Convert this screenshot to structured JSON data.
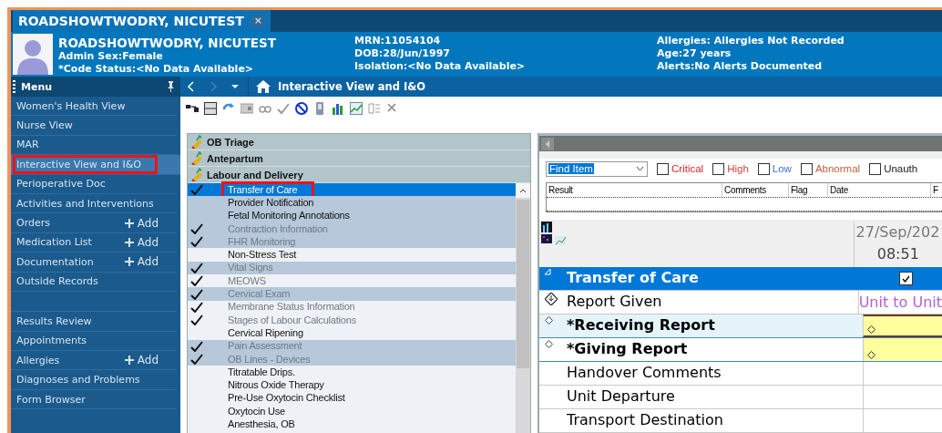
{
  "tab": {
    "label": "ROADSHOWTWODRY, NICUTEST",
    "close": "×",
    "selected": true
  },
  "banner": {
    "name": "ROADSHOWTWODRY, NICUTEST",
    "column_1": [
      "Admin Sex:Female",
      "*Code Status:<No Data Available>"
    ],
    "column_2": [
      "MRN:11054104",
      "DOB:28/Jun/1997",
      "Isolation:<No Data Available>"
    ],
    "column_3": [
      "Allergies: Allergies Not Recorded",
      "Age:27 years",
      "Alerts:No Alerts Documented"
    ]
  },
  "menu": {
    "title": "Menu",
    "items": [
      {
        "kind": "link",
        "label": "Women's Health View",
        "selected": false,
        "outlined": false
      },
      {
        "kind": "link",
        "label": "Nurse View",
        "selected": false,
        "outlined": false
      },
      {
        "kind": "link",
        "label": "MAR",
        "selected": false,
        "outlined": false
      },
      {
        "kind": "link",
        "label": "Interactive View and I&O",
        "selected": true,
        "outlined": true
      },
      {
        "kind": "link",
        "label": "Perioperative Doc",
        "selected": false,
        "outlined": false
      },
      {
        "kind": "link",
        "label": "Activities and Interventions",
        "selected": false,
        "outlined": false
      },
      {
        "kind": "link",
        "label": "Orders",
        "add": "Add",
        "selected": false,
        "outlined": false
      },
      {
        "kind": "link",
        "label": "Medication List",
        "add": "Add",
        "selected": false,
        "outlined": false
      },
      {
        "kind": "link",
        "label": "Documentation",
        "add": "Add",
        "selected": false,
        "outlined": false
      },
      {
        "kind": "link",
        "label": "Outside Records",
        "selected": false,
        "outlined": false
      },
      {
        "kind": "gap"
      },
      {
        "kind": "link",
        "label": "Results Review",
        "selected": false,
        "outlined": false
      },
      {
        "kind": "link",
        "label": "Appointments",
        "selected": false,
        "outlined": false
      },
      {
        "kind": "link",
        "label": "Allergies",
        "add": "Add",
        "selected": false,
        "outlined": false
      },
      {
        "kind": "link",
        "label": "Diagnoses and Problems",
        "selected": false,
        "outlined": false
      },
      {
        "kind": "link",
        "label": "Form Browser",
        "selected": false,
        "outlined": false
      }
    ]
  },
  "nav": {
    "title": "Interactive View and I&O"
  },
  "bands": [
    "OB Triage",
    "Antepartum",
    "Labour and Delivery"
  ],
  "sections": [
    {
      "label": "Transfer of Care",
      "checked": true,
      "selected": true,
      "outlined": true
    },
    {
      "label": "Provider Notification",
      "checked": false,
      "shaded": true,
      "selected": false,
      "outlined": false
    },
    {
      "label": "Fetal Monitoring Annotations",
      "checked": false,
      "shaded": true,
      "selected": false,
      "outlined": false
    },
    {
      "label": "Contraction Information",
      "checked": true,
      "shaded": true,
      "selected": false,
      "outlined": false
    },
    {
      "label": "FHR Monitoring",
      "checked": true,
      "shaded": true,
      "selected": false,
      "outlined": false
    },
    {
      "label": "Non-Stress Test",
      "checked": false,
      "shaded": false,
      "selected": false,
      "outlined": false
    },
    {
      "label": "Vital Signs",
      "checked": true,
      "shaded": true,
      "selected": false,
      "outlined": false
    },
    {
      "label": "MEOWS",
      "checked": true,
      "shaded": false,
      "selected": false,
      "outlined": false
    },
    {
      "label": "Cervical Exam",
      "checked": true,
      "shaded": true,
      "selected": false,
      "outlined": false
    },
    {
      "label": "Membrane Status Information",
      "checked": true,
      "shaded": false,
      "selected": false,
      "outlined": false
    },
    {
      "label": "Stages of Labour Calculations",
      "checked": true,
      "shaded": false,
      "selected": false,
      "outlined": false
    },
    {
      "label": "Cervical Ripening",
      "checked": false,
      "shaded": false,
      "selected": false,
      "outlined": false
    },
    {
      "label": "Pain Assessment",
      "checked": true,
      "shaded": true,
      "selected": false,
      "outlined": false
    },
    {
      "label": "OB Lines - Devices",
      "checked": true,
      "shaded": true,
      "selected": false,
      "outlined": false
    },
    {
      "label": "Titratable Drips.",
      "checked": false,
      "shaded": false,
      "selected": false,
      "outlined": false
    },
    {
      "label": "Nitrous Oxide Therapy",
      "checked": false,
      "shaded": false,
      "selected": false,
      "outlined": false
    },
    {
      "label": "Pre-Use Oxytocin Checklist",
      "checked": false,
      "shaded": false,
      "selected": false,
      "outlined": false
    },
    {
      "label": "Oxytocin Use",
      "checked": false,
      "shaded": false,
      "selected": false,
      "outlined": false
    },
    {
      "label": "Anesthesia, OB",
      "checked": false,
      "shaded": false,
      "selected": false,
      "outlined": false
    }
  ],
  "filter": {
    "find": "Find Item",
    "flags": [
      {
        "label": "Critical",
        "checked": false,
        "color": "#e02424"
      },
      {
        "label": "High",
        "checked": false,
        "color": "#d0453a"
      },
      {
        "label": "Low",
        "checked": false,
        "color": "#3a6ee0"
      },
      {
        "label": "Abnormal",
        "checked": false,
        "color": "#c0603a"
      },
      {
        "label": "Unauth",
        "checked": false,
        "color": "#202020"
      }
    ]
  },
  "results_table": {
    "columns": [
      "Result",
      "Comments",
      "Flag",
      "Date",
      "F"
    ]
  },
  "flowsheet": {
    "date": "27/Sep/202",
    "time": "08:51",
    "rows": [
      {
        "kind": "section",
        "label": "Transfer of Care",
        "checked": true
      },
      {
        "kind": "ordered",
        "label": "Report Given",
        "selected": false,
        "value": "Unit to Unit"
      },
      {
        "kind": "required",
        "label": "*Receiving Report",
        "selected": true
      },
      {
        "kind": "required",
        "label": "*Giving Report",
        "selected": false
      },
      {
        "kind": "plain",
        "label": "Handover Comments",
        "selected": false
      },
      {
        "kind": "plain",
        "label": "Unit Departure",
        "selected": false
      },
      {
        "kind": "plain",
        "label": "Transport Destination",
        "selected": false
      }
    ]
  }
}
